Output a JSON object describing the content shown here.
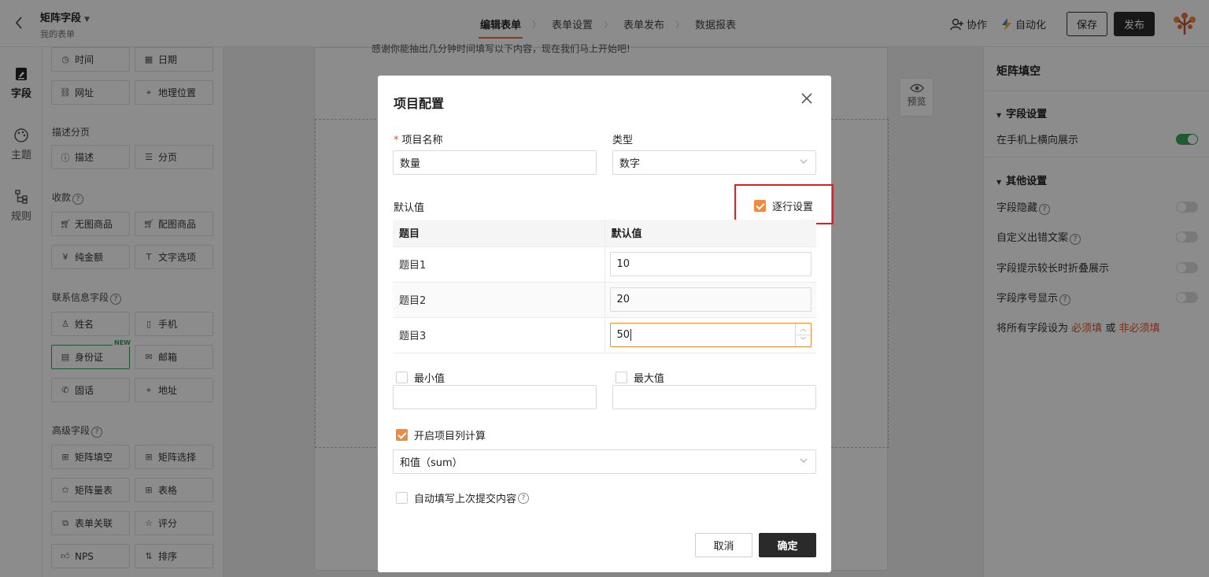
{
  "topbar": {
    "title": "矩阵字段",
    "subtitle": "我的表单",
    "steps": [
      "编辑表单",
      "表单设置",
      "表单发布",
      "数据报表"
    ],
    "collab": "协作",
    "automation": "自动化",
    "save": "保存",
    "publish": "发布"
  },
  "iconbar": {
    "items": [
      {
        "label": "字段",
        "icon": "field-icon"
      },
      {
        "label": "主题",
        "icon": "palette-icon"
      },
      {
        "label": "规则",
        "icon": "rule-icon"
      }
    ]
  },
  "fields": {
    "row_time": [
      "时间",
      "日期"
    ],
    "row_web": [
      "网址",
      "地理位置"
    ],
    "sec_desc": "描述分页",
    "row_desc": [
      "描述",
      "分页"
    ],
    "sec_pay": "收款",
    "row_pay1": [
      "无图商品",
      "配图商品"
    ],
    "row_pay2": [
      "纯金额",
      "文字选项"
    ],
    "sec_contact": "联系信息字段",
    "row_c1": [
      "姓名",
      "手机"
    ],
    "row_c2": [
      "身份证",
      "邮箱"
    ],
    "new_badge": "NEW",
    "row_c3": [
      "固话",
      "地址"
    ],
    "sec_adv": "高级字段",
    "row_a1": [
      "矩阵填空",
      "矩阵选择"
    ],
    "row_a2": [
      "矩阵量表",
      "表格"
    ],
    "row_a3": [
      "表单关联",
      "评分"
    ],
    "row_a4": [
      "NPS",
      "排序"
    ]
  },
  "canvas": {
    "intro": "感谢你能抽出几分钟时间填写以下内容，现在我们马上开始吧!",
    "preview": "预览"
  },
  "rightpanel": {
    "title": "矩阵填空",
    "sec_field": "字段设置",
    "landscape": "在手机上横向展示",
    "sec_other": "其他设置",
    "hide": "字段隐藏",
    "custom_err": "自定义出错文案",
    "collapse": "字段提示较长时折叠展示",
    "seq": "字段序号显示",
    "all_prefix": "将所有字段设为",
    "required": "必须填",
    "or": "或",
    "not_required": "非必须填"
  },
  "modal": {
    "title": "项目配置",
    "name_label": "项目名称",
    "name_value": "数量",
    "type_label": "类型",
    "type_value": "数字",
    "default_label": "默认值",
    "per_row": "逐行设置",
    "table": {
      "headers": [
        "题目",
        "默认值"
      ],
      "rows": [
        {
          "item": "题目1",
          "value": "10"
        },
        {
          "item": "题目2",
          "value": "20"
        },
        {
          "item": "题目3",
          "value": "50"
        }
      ]
    },
    "min_label": "最小值",
    "max_label": "最大值",
    "calc_label": "开启项目列计算",
    "calc_value": "和值（sum）",
    "autofill_label": "自动填写上次提交内容",
    "cancel": "取消",
    "ok": "确定"
  },
  "colors": {
    "accent": "#f08a3c",
    "danger": "#e02020",
    "toggle_on": "#3aa55a"
  }
}
